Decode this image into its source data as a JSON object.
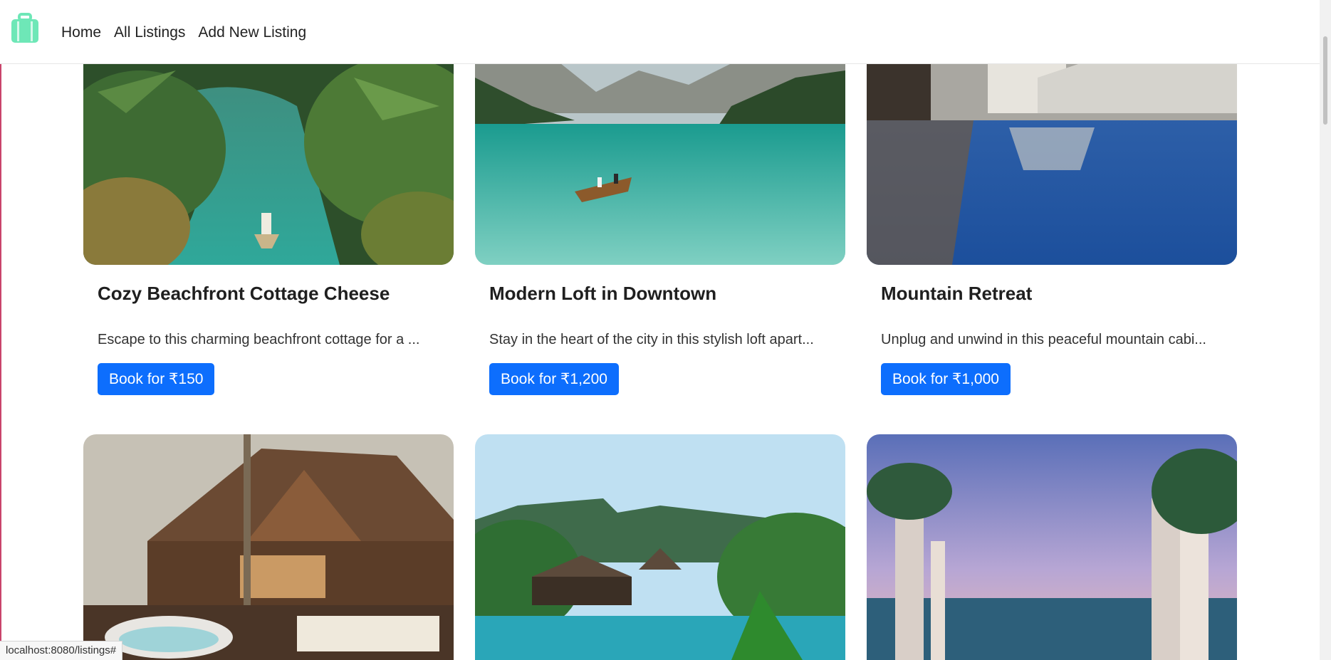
{
  "nav": {
    "logo_icon": "suitcase-icon",
    "brand_color": "#6ee7b7",
    "links": [
      {
        "label": "Home"
      },
      {
        "label": "All Listings"
      },
      {
        "label": "Add New Listing"
      }
    ]
  },
  "listings": [
    {
      "title": "Cozy Beachfront Cottage Cheese",
      "description": "Escape to this charming beachfront cottage for a ...",
      "button": "Book for ₹150",
      "image": "tropical-river-canoe-image"
    },
    {
      "title": "Modern Loft in Downtown",
      "description": "Stay in the heart of the city in this stylish loft apart...",
      "button": "Book for ₹1,200",
      "image": "mountain-lake-boat-image"
    },
    {
      "title": "Mountain Retreat",
      "description": "Unplug and unwind in this peaceful mountain cabi...",
      "button": "Book for ₹1,000",
      "image": "resort-pool-reflection-image"
    },
    {
      "image": "beach-resort-lodge-image"
    },
    {
      "image": "tropical-villa-pool-image"
    },
    {
      "image": "infinity-pool-cabanas-image"
    }
  ],
  "accent_color": "#0d6efd",
  "status_bar": {
    "url": "localhost:8080/listings#"
  }
}
